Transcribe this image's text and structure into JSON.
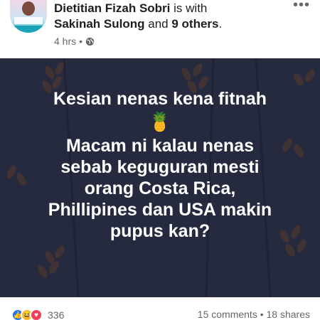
{
  "header": {
    "author": "Dietitian Fizah Sobri",
    "with_text": "is with",
    "tagged": "Sakinah Sulong",
    "and_text": "and",
    "others": "9 others",
    "period": ".",
    "time": "4 hrs",
    "separator": "•",
    "privacy_icon": "globe-icon",
    "more_icon": "more-options-icon",
    "more_glyph": "•••"
  },
  "post": {
    "line1": "Kesian nenas kena fitnah",
    "emoji": "🍍",
    "line2": "Macam ni kalau nenas",
    "line3": "sebab keguguran mesti",
    "line4": "orang Costa Rica,",
    "line5": "Phillipines dan USA makin",
    "line6": "pupus kan?",
    "background_color": "#252a3e",
    "text_color": "#ffffff"
  },
  "footer": {
    "reaction_icons": [
      "like-icon",
      "haha-icon",
      "love-icon"
    ],
    "reaction_count": "336",
    "comments": "15 comments",
    "dot": "•",
    "shares": "18 shares"
  }
}
